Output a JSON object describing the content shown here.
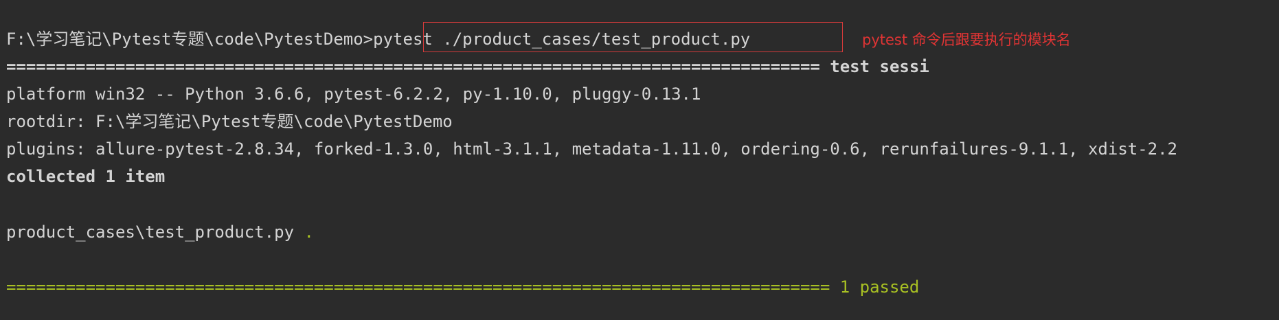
{
  "terminal": {
    "prompt": "F:\\学习笔记\\Pytest专题\\code\\PytestDemo>",
    "command": "pytest ./product_cases/test_product.py",
    "annotation": "pytest 命令后跟要执行的模块名",
    "session_separator": "================================================================================== test sessi",
    "platform_line": "platform win32 -- Python 3.6.6, pytest-6.2.2, py-1.10.0, pluggy-0.13.1",
    "rootdir_line": "rootdir: F:\\学习笔记\\Pytest专题\\code\\PytestDemo",
    "plugins_line": "plugins: allure-pytest-2.8.34, forked-1.3.0, html-3.1.1, metadata-1.11.0, ordering-0.6, rerunfailures-9.1.1, xdist-2.2",
    "collected_line": "collected 1 item",
    "result_file": "product_cases\\test_product.py ",
    "result_dot": ".",
    "summary_separator": "=================================================================================== 1 passed"
  },
  "colors": {
    "background": "#2b2b2b",
    "text": "#d4d4d4",
    "success": "#a8c023",
    "annotation": "#e03434"
  }
}
